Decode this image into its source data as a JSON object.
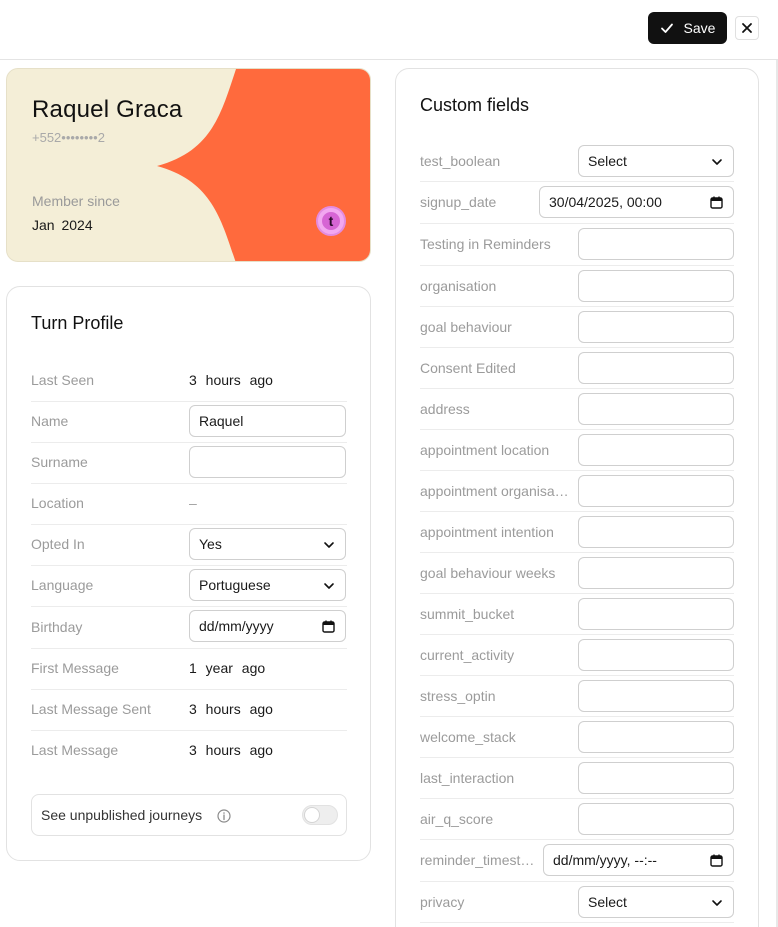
{
  "toolbar": {
    "save_label": "Save"
  },
  "profile_card": {
    "name": "Raquel Graca",
    "phone": "+552••••••••2",
    "member_since_label": "Member since",
    "member_since_value": "Jan 2024",
    "avatar_letter": "t",
    "colors": {
      "cream": "#f4eed7",
      "orange": "#ff6a3d"
    }
  },
  "turn_profile": {
    "title": "Turn Profile",
    "last_seen": {
      "label": "Last Seen",
      "value": "3 hours ago"
    },
    "name": {
      "label": "Name",
      "value": "Raquel"
    },
    "surname": {
      "label": "Surname",
      "value": ""
    },
    "location": {
      "label": "Location",
      "value": "–"
    },
    "opted_in": {
      "label": "Opted In",
      "value": "Yes"
    },
    "language": {
      "label": "Language",
      "value": "Portuguese"
    },
    "birthday": {
      "label": "Birthday",
      "value": "dd/mm/yyyy"
    },
    "first_message": {
      "label": "First Message",
      "value": "1 year ago"
    },
    "last_message_sent": {
      "label": "Last Message Sent",
      "value": "3 hours ago"
    },
    "last_message": {
      "label": "Last Message",
      "value": "3 hours ago"
    },
    "unpublished": {
      "label": "See unpublished journeys",
      "enabled": false
    }
  },
  "custom_fields": {
    "title": "Custom fields",
    "fields": [
      {
        "label": "test_boolean",
        "kind": "select",
        "value": "Select"
      },
      {
        "label": "signup_date",
        "kind": "datetime",
        "value": "30/04/2025, 00:00"
      },
      {
        "label": "Testing in Reminders",
        "kind": "text",
        "value": ""
      },
      {
        "label": "organisation",
        "kind": "text",
        "value": ""
      },
      {
        "label": "goal behaviour",
        "kind": "text",
        "value": ""
      },
      {
        "label": "Consent Edited",
        "kind": "text",
        "value": ""
      },
      {
        "label": "address",
        "kind": "text",
        "value": ""
      },
      {
        "label": "appointment location",
        "kind": "text",
        "value": ""
      },
      {
        "label": "appointment organisa…",
        "kind": "text",
        "value": ""
      },
      {
        "label": "appointment intention",
        "kind": "text",
        "value": ""
      },
      {
        "label": "goal behaviour weeks",
        "kind": "text",
        "value": ""
      },
      {
        "label": "summit_bucket",
        "kind": "text",
        "value": ""
      },
      {
        "label": "current_activity",
        "kind": "text",
        "value": ""
      },
      {
        "label": "stress_optin",
        "kind": "text",
        "value": ""
      },
      {
        "label": "welcome_stack",
        "kind": "text",
        "value": ""
      },
      {
        "label": "last_interaction",
        "kind": "text",
        "value": ""
      },
      {
        "label": "air_q_score",
        "kind": "text",
        "value": ""
      },
      {
        "label": "reminder_timest…",
        "kind": "datetime",
        "value": "dd/mm/yyyy, --:--"
      },
      {
        "label": "privacy",
        "kind": "select",
        "value": "Select"
      }
    ]
  }
}
